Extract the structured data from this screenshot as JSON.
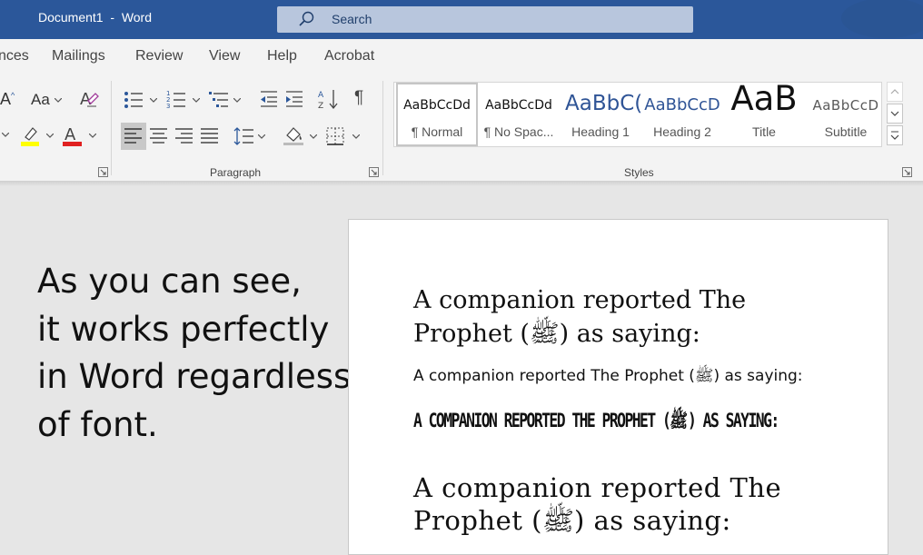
{
  "titlebar": {
    "title": "Document1  -  Word",
    "search_label": "Search"
  },
  "tabs": [
    "nces",
    "Mailings",
    "Review",
    "View",
    "Help",
    "Acrobat"
  ],
  "groups": {
    "paragraph_label": "Paragraph",
    "styles_label": "Styles"
  },
  "ribbon_text": {
    "font_grow": "A",
    "change_case": "Aa",
    "font_color": "A",
    "pilcrow": "¶"
  },
  "styles": [
    {
      "sample": "AaBbCcDd",
      "name": "¶ Normal"
    },
    {
      "sample": "AaBbCcDd",
      "name": "¶ No Spac..."
    },
    {
      "sample": "AaBbC(",
      "name": "Heading 1"
    },
    {
      "sample": "AaBbCcD",
      "name": "Heading 2"
    },
    {
      "sample": "AaB",
      "name": "Title"
    },
    {
      "sample": "AaBbCcD",
      "name": "Subtitle"
    }
  ],
  "colors": {
    "titlebar": "#2b579a",
    "highlight": "#ffff00",
    "font_color": "#e02020",
    "heading": "#2f5496"
  },
  "caption": {
    "line1": "As you can see,",
    "line2": "it works perfectly",
    "line3": "in Word regardless",
    "line4": "of font."
  },
  "document": {
    "para1": "A companion reported The Prophet (ﷺ) as saying:",
    "para2": "A companion reported The Prophet (ﷺ) as saying:",
    "para3": "A companion reported The Prophet (ﷺ) as saying:",
    "para4": "A companion reported The Prophet (ﷺ) as saying:"
  }
}
